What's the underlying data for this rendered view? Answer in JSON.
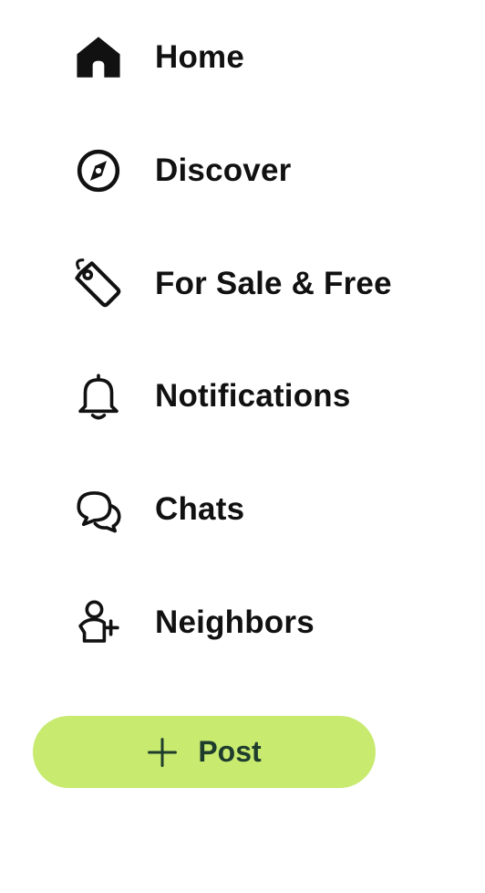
{
  "nav": {
    "items": [
      {
        "label": "Home",
        "icon": "home-icon"
      },
      {
        "label": "Discover",
        "icon": "compass-icon"
      },
      {
        "label": "For Sale & Free",
        "icon": "tag-icon"
      },
      {
        "label": "Notifications",
        "icon": "bell-icon"
      },
      {
        "label": "Chats",
        "icon": "chat-bubbles-icon"
      },
      {
        "label": "Neighbors",
        "icon": "add-person-icon"
      }
    ]
  },
  "post_button": {
    "label": "Post",
    "icon": "plus-icon"
  },
  "colors": {
    "text": "#111111",
    "post_background": "#c7ea6f",
    "post_text": "#1f3d2d"
  }
}
